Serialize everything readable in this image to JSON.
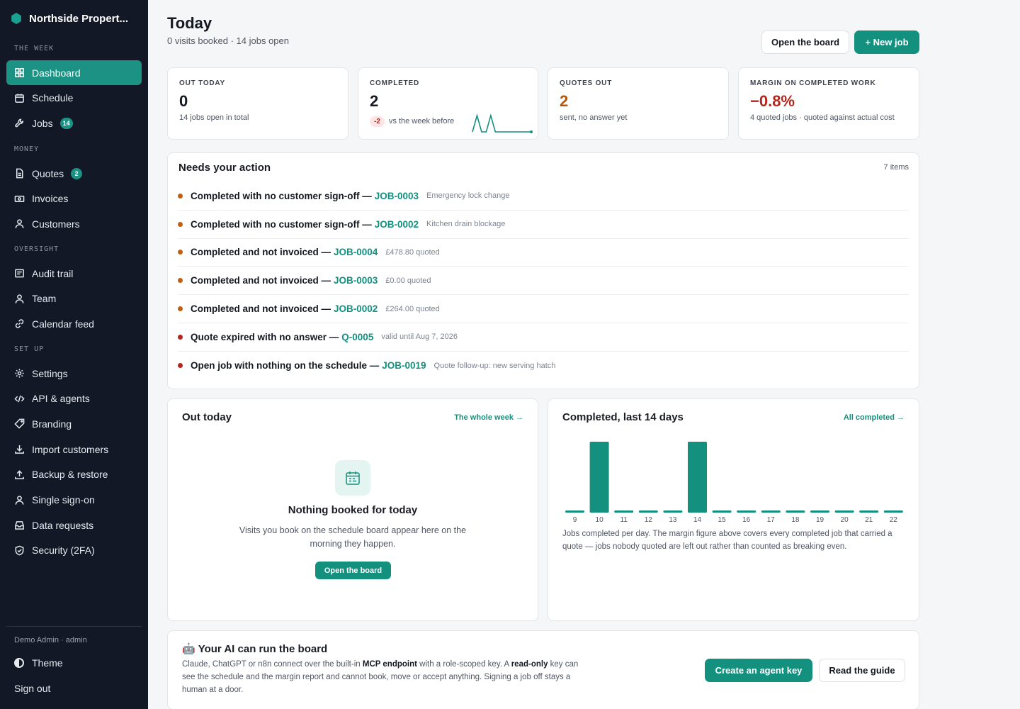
{
  "app": {
    "name": "Northside Propert..."
  },
  "sidebar": {
    "sections": [
      {
        "label": "THE WEEK",
        "items": [
          {
            "label": "Dashboard",
            "icon": "grid-icon",
            "active": true
          },
          {
            "label": "Schedule",
            "icon": "calendar-icon"
          },
          {
            "label": "Jobs",
            "icon": "wrench-icon",
            "badge": "14"
          }
        ]
      },
      {
        "label": "MONEY",
        "items": [
          {
            "label": "Quotes",
            "icon": "document-icon",
            "badge": "2"
          },
          {
            "label": "Invoices",
            "icon": "banknote-icon"
          },
          {
            "label": "Customers",
            "icon": "user-icon"
          }
        ]
      },
      {
        "label": "OVERSIGHT",
        "items": [
          {
            "label": "Audit trail",
            "icon": "list-icon"
          },
          {
            "label": "Team",
            "icon": "user-icon"
          },
          {
            "label": "Calendar feed",
            "icon": "link-icon"
          }
        ]
      },
      {
        "label": "SET UP",
        "items": [
          {
            "label": "Settings",
            "icon": "gear-icon"
          },
          {
            "label": "API & agents",
            "icon": "code-icon"
          },
          {
            "label": "Branding",
            "icon": "tag-icon"
          },
          {
            "label": "Import customers",
            "icon": "download-icon"
          },
          {
            "label": "Backup & restore",
            "icon": "upload-icon"
          },
          {
            "label": "Single sign-on",
            "icon": "user-icon"
          },
          {
            "label": "Data requests",
            "icon": "inbox-icon"
          },
          {
            "label": "Security (2FA)",
            "icon": "shield-icon"
          }
        ]
      }
    ],
    "user": "Demo Admin · admin",
    "theme_label": "Theme",
    "signout_label": "Sign out"
  },
  "header": {
    "title": "Today",
    "subtitle": "0 visits booked · 14 jobs open",
    "open_board_label": "Open the board",
    "new_job_label": "+ New job"
  },
  "stats": [
    {
      "label": "OUT TODAY",
      "value": "0",
      "note": "14 jobs open in total"
    },
    {
      "label": "COMPLETED",
      "value": "2",
      "delta": "-2",
      "note": "vs the week before",
      "sparkline": [
        0,
        2,
        0,
        0,
        2,
        0,
        0,
        0,
        0,
        0,
        0,
        0,
        0,
        0
      ]
    },
    {
      "label": "QUOTES OUT",
      "value": "2",
      "note": "sent, no answer yet"
    },
    {
      "label": "MARGIN ON COMPLETED WORK",
      "value": "−0.8%",
      "note": "4 quoted jobs · quoted against actual cost"
    }
  ],
  "actions": {
    "title": "Needs your action",
    "count": "7 items",
    "items": [
      {
        "text": "Completed with no customer sign-off —",
        "ref": "JOB-0003",
        "meta": "Emergency lock change",
        "severity": "warning"
      },
      {
        "text": "Completed with no customer sign-off —",
        "ref": "JOB-0002",
        "meta": "Kitchen drain blockage",
        "severity": "warning"
      },
      {
        "text": "Completed and not invoiced —",
        "ref": "JOB-0004",
        "meta": "£478.80 quoted",
        "severity": "warning"
      },
      {
        "text": "Completed and not invoiced —",
        "ref": "JOB-0003",
        "meta": "£0.00 quoted",
        "severity": "warning"
      },
      {
        "text": "Completed and not invoiced —",
        "ref": "JOB-0002",
        "meta": "£264.00 quoted",
        "severity": "warning"
      },
      {
        "text": "Quote expired with no answer —",
        "ref": "Q-0005",
        "meta": "valid until Aug 7, 2026",
        "severity": "danger"
      },
      {
        "text": "Open job with nothing on the schedule —",
        "ref": "JOB-0019",
        "meta": "Quote follow-up: new serving hatch",
        "severity": "danger"
      }
    ]
  },
  "out_today": {
    "title": "Out today",
    "link": "The whole week →",
    "empty_title": "Nothing booked for today",
    "empty_body": "Visits you book on the schedule board appear here on the morning they happen.",
    "button": "Open the board"
  },
  "completed_panel": {
    "title": "Completed, last 14 days",
    "link": "All completed →",
    "note": "Jobs completed per day. The margin figure above covers every completed job that carried a quote — jobs nobody quoted are left out rather than counted as breaking even."
  },
  "chart_data": {
    "type": "bar",
    "categories": [
      "9",
      "10",
      "11",
      "12",
      "13",
      "14",
      "15",
      "16",
      "17",
      "18",
      "19",
      "20",
      "21",
      "22"
    ],
    "values": [
      0,
      1,
      0,
      0,
      0,
      1,
      0,
      0,
      0,
      0,
      0,
      0,
      0,
      0
    ],
    "title": "Completed, last 14 days",
    "xlabel": "",
    "ylabel": "",
    "ylim": [
      0,
      1
    ],
    "grid": false
  },
  "ai": {
    "emoji": "🤖",
    "title": "Your AI can run the board",
    "body_1": "Claude, ChatGPT or n8n connect over the built-in ",
    "body_bold_1": "MCP endpoint",
    "body_2": " with a role-scoped key. A ",
    "body_bold_2": "read-only",
    "body_3": " key can see the schedule and the margin report and cannot book, move or accept anything. Signing a job off stays a human at a door.",
    "primary_label": "Create an agent key",
    "secondary_label": "Read the guide"
  },
  "colors": {
    "accent": "#14907f",
    "sidebar": "#121826",
    "warning": "#c2600f",
    "danger": "#b3261e"
  }
}
